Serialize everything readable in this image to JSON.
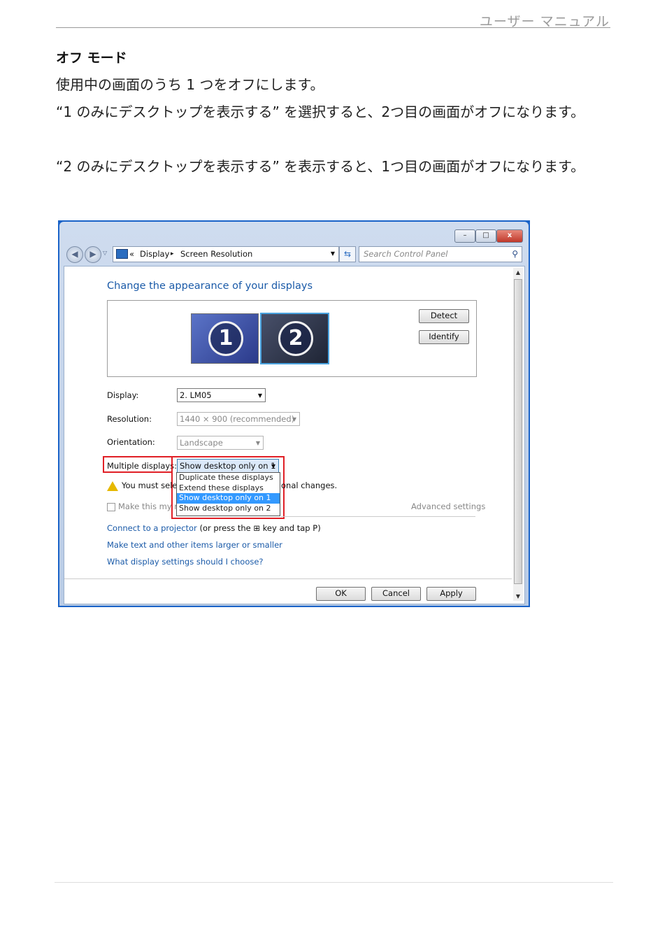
{
  "header": {
    "title": "ユーザー マニュアル"
  },
  "doc": {
    "heading": "オフ モード",
    "p1": "使用中の画面のうち 1 つをオフにします。",
    "p2": "“1 のみにデスクトップを表示する” を選択すると、2つ目の画面がオフになります。",
    "p3": "“2 のみにデスクトップを表示する” を表示すると、1つ目の画面がオフになります。"
  },
  "window": {
    "controls": {
      "minimize": "–",
      "maximize": "□",
      "close": "x"
    },
    "breadcrumb": {
      "sep": "«",
      "item1": "Display",
      "arrow": "▸",
      "item2": "Screen Resolution"
    },
    "search_placeholder": "Search Control Panel",
    "heading": "Change the appearance of your displays",
    "monitor1": "1",
    "monitor2": "2",
    "detect": "Detect",
    "identify": "Identify",
    "display_label": "Display:",
    "display_value": "2. LM05",
    "resolution_label": "Resolution:",
    "resolution_value": "1440 × 900 (recommended)",
    "orientation_label": "Orientation:",
    "orientation_value": "Landscape",
    "multiple_label": "Multiple displays:",
    "multiple_value": "Show desktop only on 1",
    "options": [
      "Duplicate these displays",
      "Extend these displays",
      "Show desktop only on 1",
      "Show desktop only on 2"
    ],
    "warning_left": "You must selec",
    "warning_right": "onal changes.",
    "checkbox_text": "Make this my m",
    "advanced": "Advanced settings",
    "projector_link": "Connect to a projector",
    "projector_text": " (or press the ⊞ key and tap P)",
    "link_text_size": "Make text and other items larger or smaller",
    "link_what": "What display settings should I choose?",
    "ok": "OK",
    "cancel": "Cancel",
    "apply": "Apply"
  }
}
